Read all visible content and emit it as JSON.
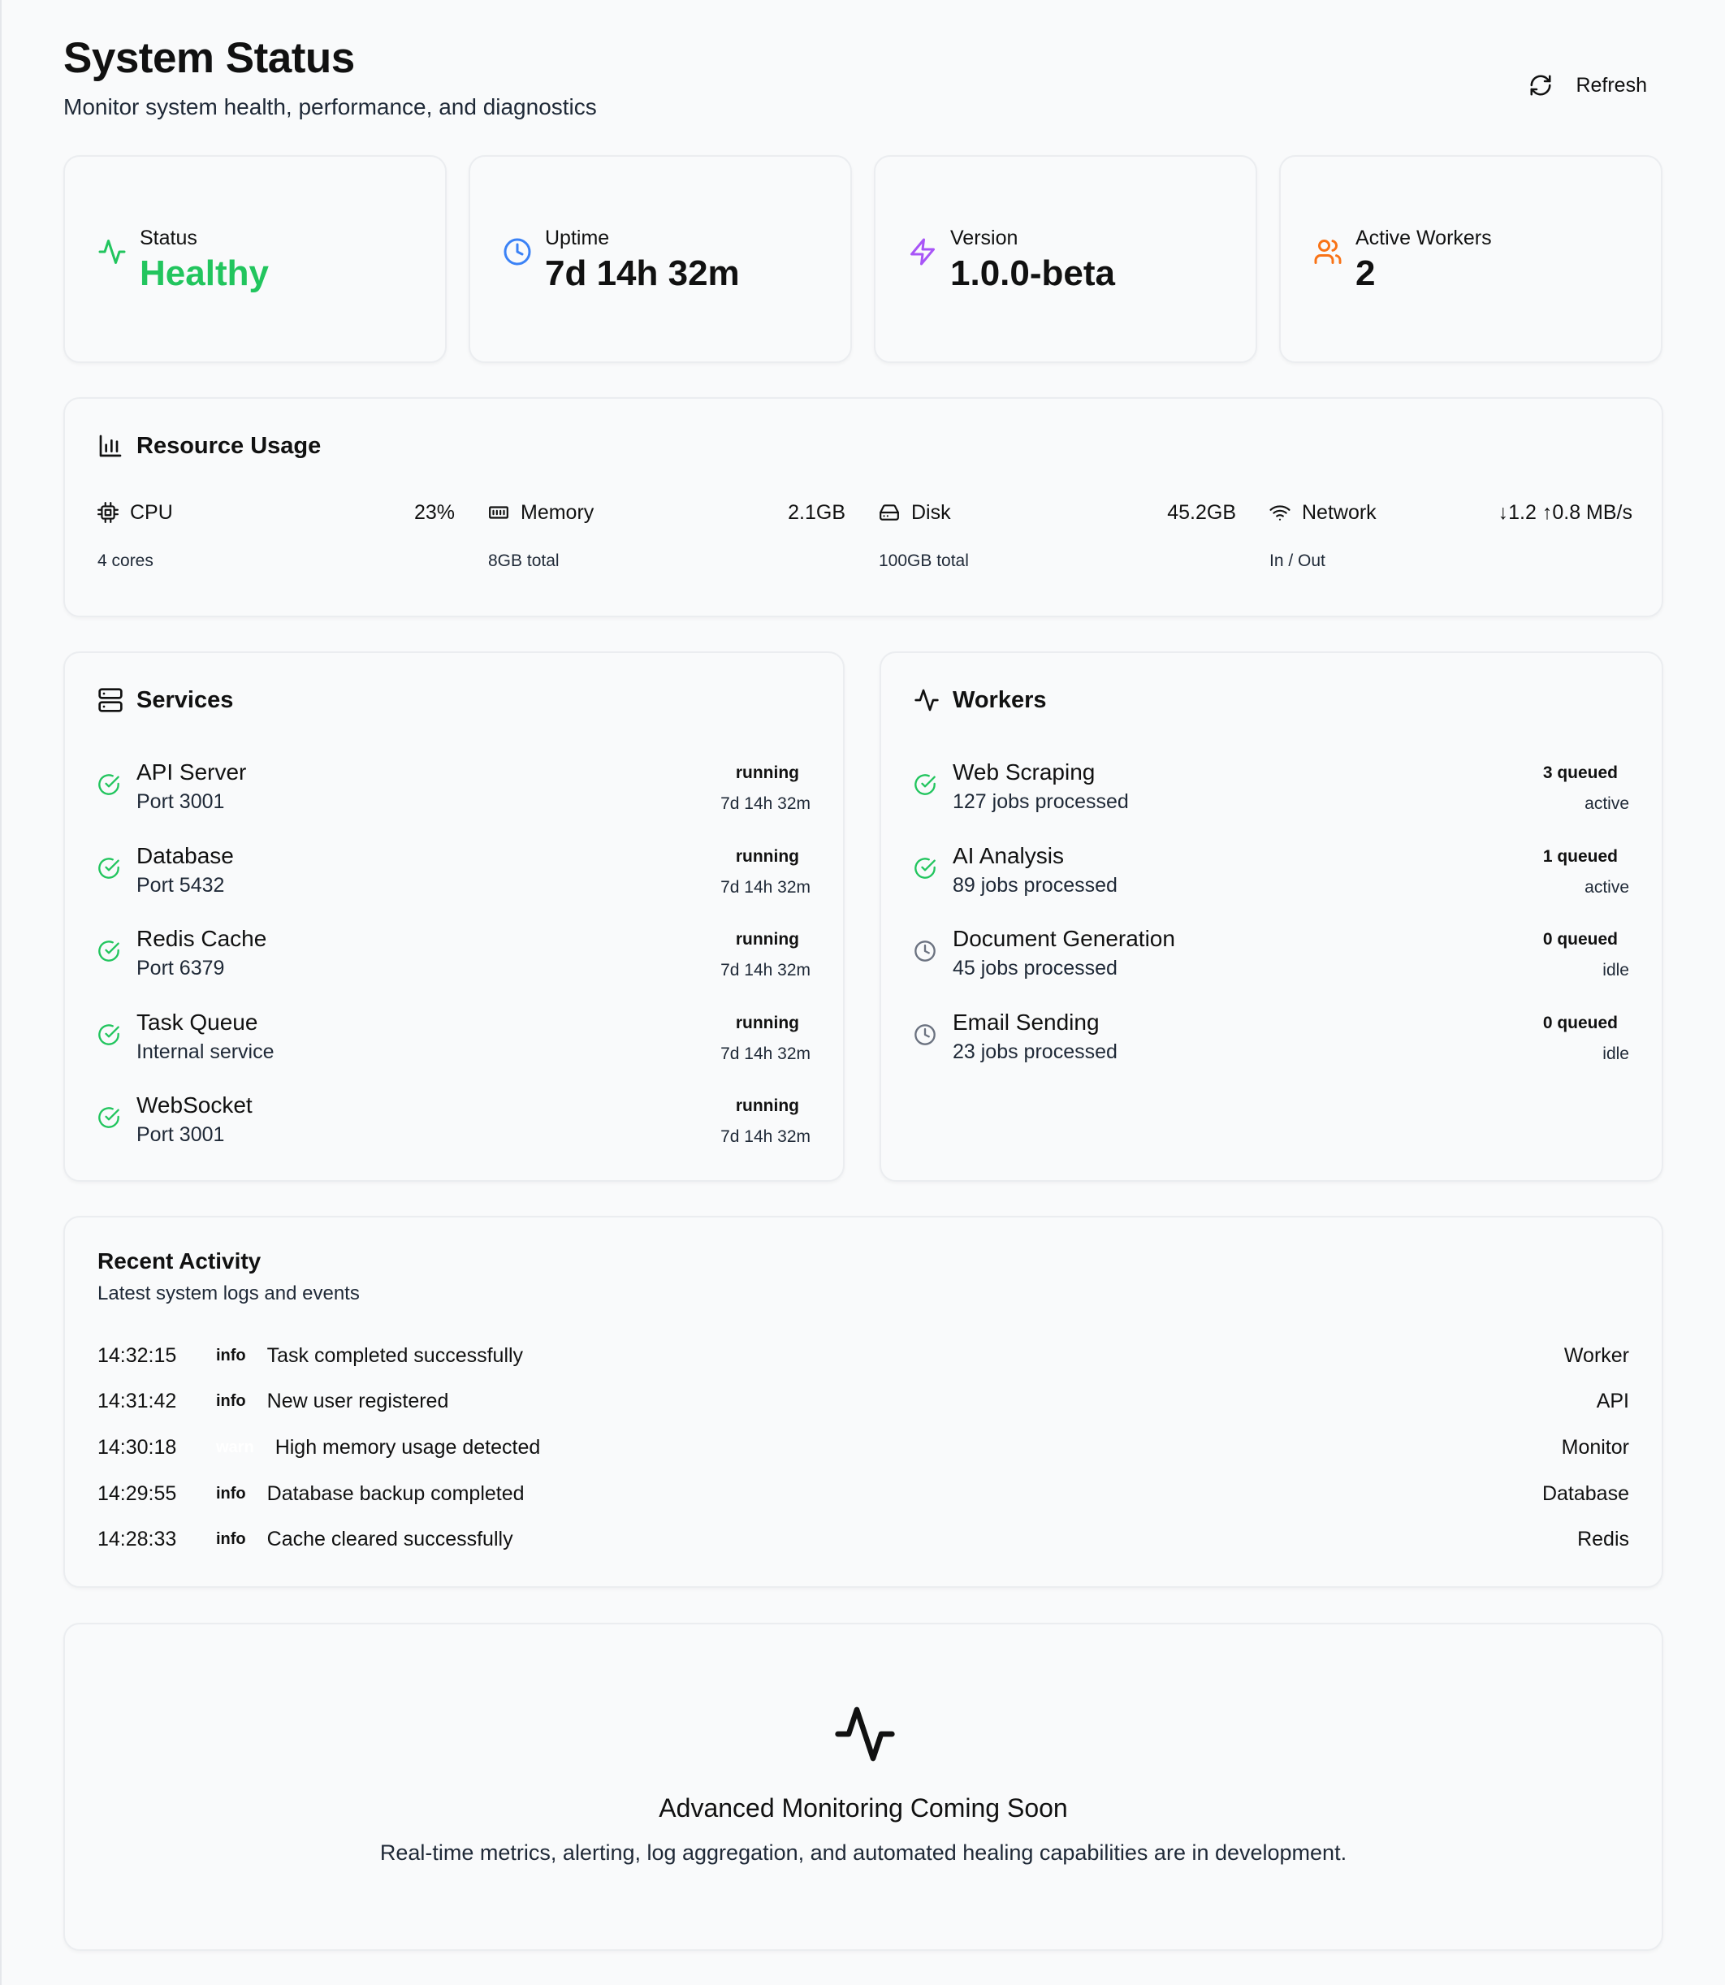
{
  "header": {
    "title": "System Status",
    "subtitle": "Monitor system health, performance, and diagnostics",
    "refresh_label": "Refresh"
  },
  "stats": [
    {
      "label": "Status",
      "value": "Healthy",
      "icon": "activity-icon",
      "color": "#22c55e"
    },
    {
      "label": "Uptime",
      "value": "7d 14h 32m",
      "icon": "clock-icon",
      "color": "#3b82f6"
    },
    {
      "label": "Version",
      "value": "1.0.0-beta",
      "icon": "zap-icon",
      "color": "#a855f7"
    },
    {
      "label": "Active Workers",
      "value": "2",
      "icon": "users-icon",
      "color": "#f97316"
    }
  ],
  "resources": {
    "title": "Resource Usage",
    "items": [
      {
        "name": "CPU",
        "value": "23%",
        "sub": "4 cores",
        "icon": "cpu-icon"
      },
      {
        "name": "Memory",
        "value": "2.1GB",
        "sub": "8GB total",
        "icon": "memory-icon"
      },
      {
        "name": "Disk",
        "value": "45.2GB",
        "sub": "100GB total",
        "icon": "disk-icon"
      },
      {
        "name": "Network",
        "value": "↓1.2 ↑0.8 MB/s",
        "sub": "In / Out",
        "icon": "wifi-icon"
      }
    ]
  },
  "services": {
    "title": "Services",
    "items": [
      {
        "name": "API Server",
        "detail": "Port 3001",
        "status": "running",
        "uptime": "7d 14h 32m"
      },
      {
        "name": "Database",
        "detail": "Port 5432",
        "status": "running",
        "uptime": "7d 14h 32m"
      },
      {
        "name": "Redis Cache",
        "detail": "Port 6379",
        "status": "running",
        "uptime": "7d 14h 32m"
      },
      {
        "name": "Task Queue",
        "detail": "Internal service",
        "status": "running",
        "uptime": "7d 14h 32m"
      },
      {
        "name": "WebSocket",
        "detail": "Port 3001",
        "status": "running",
        "uptime": "7d 14h 32m"
      }
    ]
  },
  "workers": {
    "title": "Workers",
    "items": [
      {
        "name": "Web Scraping",
        "detail": "127 jobs processed",
        "queued": "3 queued",
        "state": "active"
      },
      {
        "name": "AI Analysis",
        "detail": "89 jobs processed",
        "queued": "1 queued",
        "state": "active"
      },
      {
        "name": "Document Generation",
        "detail": "45 jobs processed",
        "queued": "0 queued",
        "state": "idle"
      },
      {
        "name": "Email Sending",
        "detail": "23 jobs processed",
        "queued": "0 queued",
        "state": "idle"
      }
    ]
  },
  "activity": {
    "title": "Recent Activity",
    "subtitle": "Latest system logs and events",
    "logs": [
      {
        "time": "14:32:15",
        "level": "info",
        "message": "Task completed successfully",
        "source": "Worker"
      },
      {
        "time": "14:31:42",
        "level": "info",
        "message": "New user registered",
        "source": "API"
      },
      {
        "time": "14:30:18",
        "level": "warn",
        "message": "High memory usage detected",
        "source": "Monitor"
      },
      {
        "time": "14:29:55",
        "level": "info",
        "message": "Database backup completed",
        "source": "Database"
      },
      {
        "time": "14:28:33",
        "level": "info",
        "message": "Cache cleared successfully",
        "source": "Redis"
      }
    ]
  },
  "coming_soon": {
    "title": "Advanced Monitoring Coming Soon",
    "text": "Real-time metrics, alerting, log aggregation, and automated healing capabilities are in development."
  },
  "colors": {
    "success": "#22c55e",
    "muted": "#6b7280"
  }
}
